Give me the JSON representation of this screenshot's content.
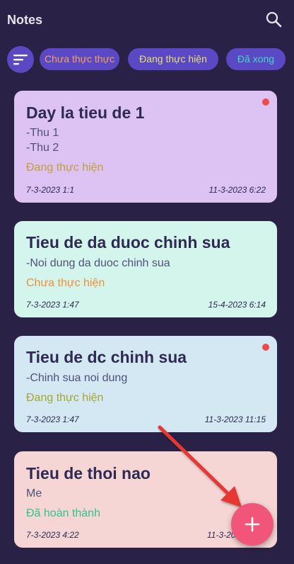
{
  "app_title": "Notes",
  "filters": {
    "chips": [
      {
        "label": "Chưa thực thực",
        "color": "#f5a05a"
      },
      {
        "label": "Đang thực hiện",
        "color": "#e8e070"
      },
      {
        "label": "Đã xong",
        "color": "#45d6c8"
      }
    ]
  },
  "notes": [
    {
      "title": "Day la tieu de 1",
      "body": "-Thu 1\n-Thu 2",
      "status": "Đang thực hiện",
      "created": "7-3-2023 1:1",
      "modified": "11-3-2023 6:22",
      "color": "#dcc3f3",
      "status_color": "#c0a03a",
      "has_dot": true
    },
    {
      "title": "Tieu de da duoc chinh sua",
      "body": "-Noi dung da duoc chinh sua",
      "status": "Chưa thực hiện",
      "created": "7-3-2023 1:47",
      "modified": "15-4-2023 6:14",
      "color": "#d4f5ec",
      "status_color": "#f0903a",
      "has_dot": false
    },
    {
      "title": "Tieu de dc chinh sua",
      "body": "-Chinh sua noi dung",
      "status": "Đang thực hiện",
      "created": "7-3-2023 1:47",
      "modified": "11-3-2023 11:15",
      "color": "#d3e8f3",
      "status_color": "#a3a830",
      "has_dot": true
    },
    {
      "title": "Tieu de thoi nao",
      "body": "Me",
      "status": "Đã hoàn thành",
      "created": "7-3-2023 4:22",
      "modified": "11-3-2023",
      "color": "#f6d6d5",
      "status_color": "#2ec58e",
      "has_dot": false
    }
  ],
  "fab": {
    "icon": "plus-icon",
    "color": "#f2557a"
  },
  "annotation_color": "#e53935"
}
